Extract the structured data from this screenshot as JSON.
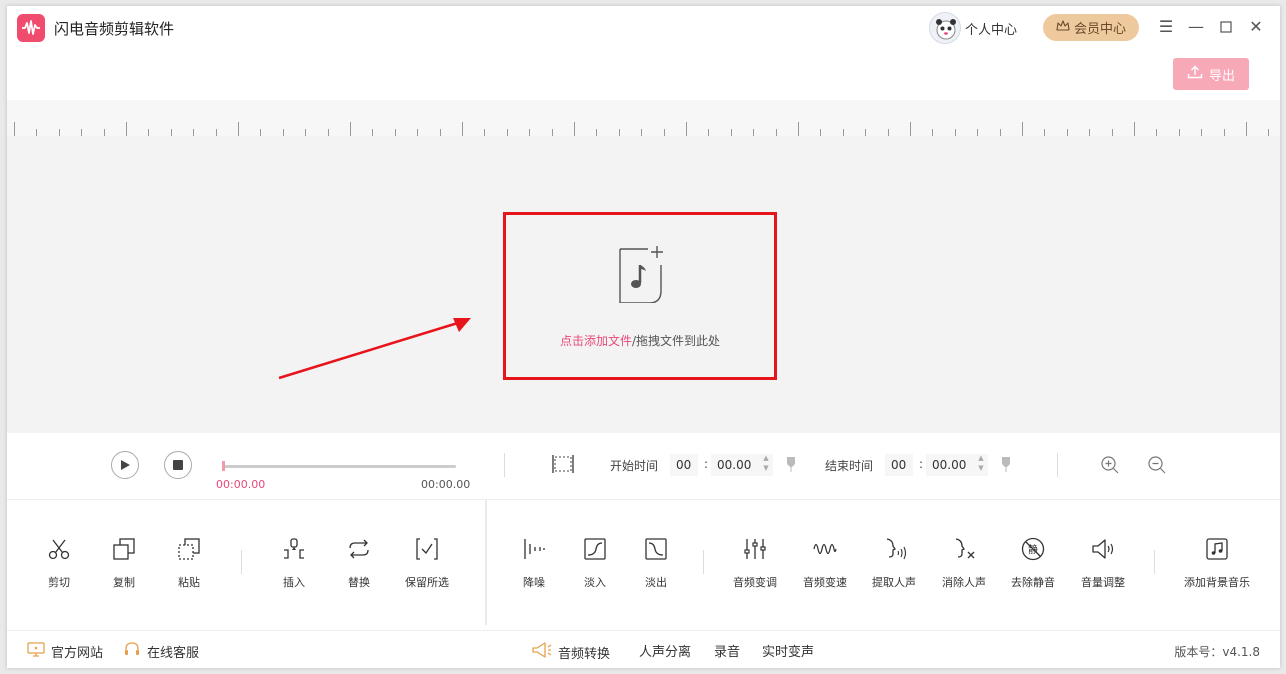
{
  "app": {
    "title": "闪电音频剪辑软件"
  },
  "header": {
    "user_center": "个人中心",
    "vip_center": "会员中心",
    "export": "导出"
  },
  "drop": {
    "link_text": "点击添加文件",
    "rest_text": "/拖拽文件到此处"
  },
  "player": {
    "current_time": "00:00.00",
    "total_time": "00:00.00",
    "progress": 0,
    "start": {
      "label": "开始时间",
      "minutes": "00",
      "seconds": "00.00"
    },
    "end": {
      "label": "结束时间",
      "minutes": "00",
      "seconds": "00.00"
    }
  },
  "tools": {
    "cut": "剪切",
    "copy": "复制",
    "paste": "粘贴",
    "insert": "插入",
    "replace": "替换",
    "keep": "保留所选",
    "denoise": "降噪",
    "fade_in": "淡入",
    "fade_out": "淡出",
    "pitch": "音频变调",
    "speed": "音频变速",
    "extract_voice": "提取人声",
    "remove_voice": "消除人声",
    "remove_silence": "去除静音",
    "volume": "音量调整",
    "bgm": "添加背景音乐"
  },
  "footer": {
    "website": "官方网站",
    "support": "在线客服",
    "convert": "音频转换",
    "separate": "人声分离",
    "record": "录音",
    "voice_change": "实时变声",
    "version": "版本号：v4.1.8"
  },
  "colors": {
    "accent": "#e8497a",
    "export_bg": "#f7a9b8",
    "vip_bg": "#efc99e",
    "highlight_border": "#e8141c"
  }
}
